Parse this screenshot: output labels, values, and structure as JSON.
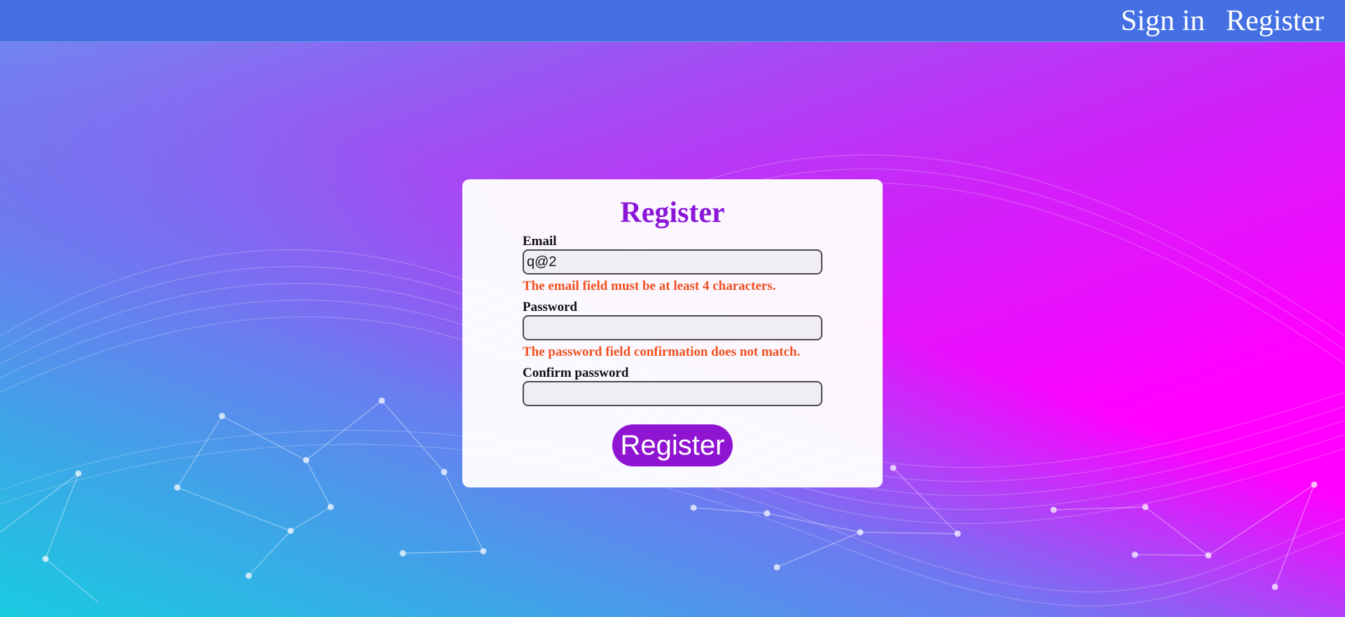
{
  "nav": {
    "sign_in": "Sign in",
    "register": "Register"
  },
  "form": {
    "title": "Register",
    "email": {
      "label": "Email",
      "value": "q@2",
      "error": "The email field must be at least 4 characters."
    },
    "password": {
      "label": "Password",
      "value": "",
      "error": "The password field confirmation does not match."
    },
    "confirm_password": {
      "label": "Confirm password",
      "value": ""
    },
    "submit_label": "Register"
  },
  "colors": {
    "topbar": "#4470e3",
    "title": "#8a17d8",
    "error": "#f0501e",
    "button": "#8f15d2"
  }
}
